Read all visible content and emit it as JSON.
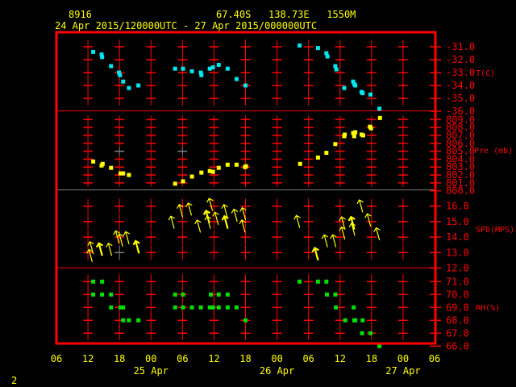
{
  "header": {
    "station_id": "8916",
    "location": "67.40S   138.73E   1550M",
    "period": "24 Apr 2015/120000UTC - 27 Apr 2015/000000UTC"
  },
  "page_number": "2",
  "colors": {
    "frame": "#ff0000",
    "text": "#ffff00",
    "temperature": "#00e5ee",
    "pressure": "#ffff00",
    "wind": "#ffff00",
    "humidity": "#00e000",
    "minor_grid": "#808080"
  },
  "chart_data": {
    "type": "scatter",
    "x_unit": "hours since 24 Apr 2015 06 UTC",
    "xlim": [
      0,
      72
    ],
    "x_ticks": [
      "06",
      "12",
      "18",
      "00",
      "06",
      "12",
      "18",
      "00",
      "06",
      "12",
      "18",
      "00",
      "06"
    ],
    "x_date_labels": [
      {
        "label": "25 Apr",
        "hour": 18
      },
      {
        "label": "26 Apr",
        "hour": 42
      },
      {
        "label": "27 Apr",
        "hour": 66
      }
    ],
    "panels": [
      {
        "name": "T(C)",
        "ylim": [
          -36,
          -31
        ],
        "tick_labels": [
          "-31.0",
          "-32.0",
          "-33.0",
          "-34.0",
          "-35.0",
          "-36.0"
        ],
        "points": [
          [
            7.0,
            -31.4
          ],
          [
            8.6,
            -31.6
          ],
          [
            8.7,
            -31.8
          ],
          [
            10.4,
            -32.5
          ],
          [
            11.9,
            -33.0
          ],
          [
            12.1,
            -33.2
          ],
          [
            12.7,
            -33.7
          ],
          [
            13.8,
            -34.2
          ],
          [
            15.6,
            -34.0
          ],
          [
            22.6,
            -32.7
          ],
          [
            24.1,
            -32.7
          ],
          [
            25.8,
            -32.9
          ],
          [
            27.5,
            -33.0
          ],
          [
            27.6,
            -33.2
          ],
          [
            29.2,
            -32.7
          ],
          [
            29.8,
            -32.6
          ],
          [
            30.9,
            -32.4
          ],
          [
            32.6,
            -32.7
          ],
          [
            34.3,
            -33.5
          ],
          [
            36.0,
            -34.0
          ],
          [
            46.3,
            -30.9
          ],
          [
            49.8,
            -31.1
          ],
          [
            51.4,
            -31.5
          ],
          [
            51.6,
            -31.75
          ],
          [
            53.1,
            -32.5
          ],
          [
            53.3,
            -32.75
          ],
          [
            54.8,
            -34.2
          ],
          [
            56.5,
            -33.7
          ],
          [
            56.7,
            -33.9
          ],
          [
            56.9,
            -34.0
          ],
          [
            58.1,
            -34.5
          ],
          [
            58.3,
            -34.6
          ],
          [
            59.8,
            -34.7
          ],
          [
            61.5,
            -35.8
          ]
        ]
      },
      {
        "name": "Pre (mb)",
        "ylim": [
          800,
          809
        ],
        "tick_labels": [
          "809.0",
          "808.0",
          "807.0",
          "806.0",
          "805.0",
          "804.0",
          "803.0",
          "802.0",
          "801.0",
          "800.0"
        ],
        "points": [
          [
            7.0,
            803.7
          ],
          [
            8.6,
            803.2
          ],
          [
            8.8,
            803.4
          ],
          [
            10.4,
            802.9
          ],
          [
            12.2,
            802.2
          ],
          [
            12.7,
            802.2
          ],
          [
            13.8,
            802.0
          ],
          [
            22.6,
            800.9
          ],
          [
            24.1,
            801.2
          ],
          [
            25.8,
            801.8
          ],
          [
            27.6,
            802.3
          ],
          [
            29.2,
            802.5
          ],
          [
            29.8,
            802.4
          ],
          [
            30.9,
            802.9
          ],
          [
            32.6,
            803.3
          ],
          [
            34.3,
            803.3
          ],
          [
            35.9,
            803.0
          ],
          [
            36.1,
            803.1
          ],
          [
            46.4,
            803.4
          ],
          [
            49.8,
            804.2
          ],
          [
            51.4,
            804.8
          ],
          [
            53.1,
            805.9
          ],
          [
            54.8,
            806.9
          ],
          [
            54.9,
            807.1
          ],
          [
            56.5,
            807.3
          ],
          [
            56.7,
            806.9
          ],
          [
            56.9,
            807.4
          ],
          [
            58.1,
            807.1
          ],
          [
            58.4,
            807.0
          ],
          [
            59.7,
            808.1
          ],
          [
            59.9,
            807.9
          ],
          [
            61.6,
            809.2
          ]
        ]
      },
      {
        "name": "SPD(MPS)",
        "ylim": [
          12,
          16
        ],
        "tick_labels": [
          "16.0",
          "15.0",
          "14.0",
          "13.0",
          "12.0"
        ],
        "points": [
          [
            6.7,
            13.3
          ],
          [
            6.5,
            12.8
          ],
          [
            8.4,
            13.2
          ],
          [
            10.2,
            13.2
          ],
          [
            11.6,
            14.0
          ],
          [
            12.3,
            13.8
          ],
          [
            13.5,
            13.95
          ],
          [
            15.4,
            13.35
          ],
          [
            22.1,
            14.95
          ],
          [
            23.7,
            15.7
          ],
          [
            25.4,
            15.8
          ],
          [
            27.1,
            14.7
          ],
          [
            28.8,
            15.3
          ],
          [
            29.0,
            14.95
          ],
          [
            29.4,
            16.1
          ],
          [
            30.5,
            15.2
          ],
          [
            32.2,
            15.7
          ],
          [
            32.3,
            14.95
          ],
          [
            34.1,
            15.4
          ],
          [
            35.7,
            15.5
          ],
          [
            35.6,
            14.7
          ],
          [
            46.0,
            15.0
          ],
          [
            49.5,
            12.9
          ],
          [
            51.3,
            13.75
          ],
          [
            52.9,
            13.75
          ],
          [
            54.6,
            14.25
          ],
          [
            54.6,
            14.9
          ],
          [
            56.4,
            14.9
          ],
          [
            56.5,
            14.5
          ],
          [
            58.0,
            16.0
          ],
          [
            59.5,
            15.1
          ],
          [
            61.2,
            14.2
          ]
        ]
      },
      {
        "name": "RH(%)",
        "ylim": [
          66,
          71
        ],
        "tick_labels": [
          "71.0",
          "70.0",
          "69.0",
          "68.0",
          "67.0",
          "66.0"
        ],
        "points": [
          [
            7.0,
            71
          ],
          [
            8.7,
            71
          ],
          [
            46.3,
            71
          ],
          [
            49.8,
            71
          ],
          [
            51.4,
            71
          ],
          [
            7.0,
            70
          ],
          [
            8.7,
            70
          ],
          [
            10.4,
            70
          ],
          [
            22.6,
            70
          ],
          [
            24.1,
            70
          ],
          [
            29.4,
            70
          ],
          [
            30.9,
            70
          ],
          [
            32.6,
            70
          ],
          [
            51.5,
            70
          ],
          [
            53.1,
            70
          ],
          [
            10.4,
            69
          ],
          [
            12.2,
            69
          ],
          [
            12.7,
            69
          ],
          [
            22.6,
            69
          ],
          [
            24.1,
            69
          ],
          [
            25.8,
            69
          ],
          [
            27.5,
            69
          ],
          [
            29.2,
            69
          ],
          [
            29.8,
            69
          ],
          [
            30.9,
            69
          ],
          [
            32.6,
            69
          ],
          [
            34.3,
            69
          ],
          [
            53.2,
            69
          ],
          [
            56.6,
            69
          ],
          [
            12.7,
            68
          ],
          [
            13.8,
            68
          ],
          [
            15.6,
            68
          ],
          [
            36.0,
            68
          ],
          [
            55.0,
            68
          ],
          [
            56.7,
            68
          ],
          [
            56.9,
            68
          ],
          [
            58.3,
            68
          ],
          [
            58.2,
            67
          ],
          [
            59.8,
            67
          ],
          [
            61.5,
            66
          ]
        ]
      }
    ]
  }
}
